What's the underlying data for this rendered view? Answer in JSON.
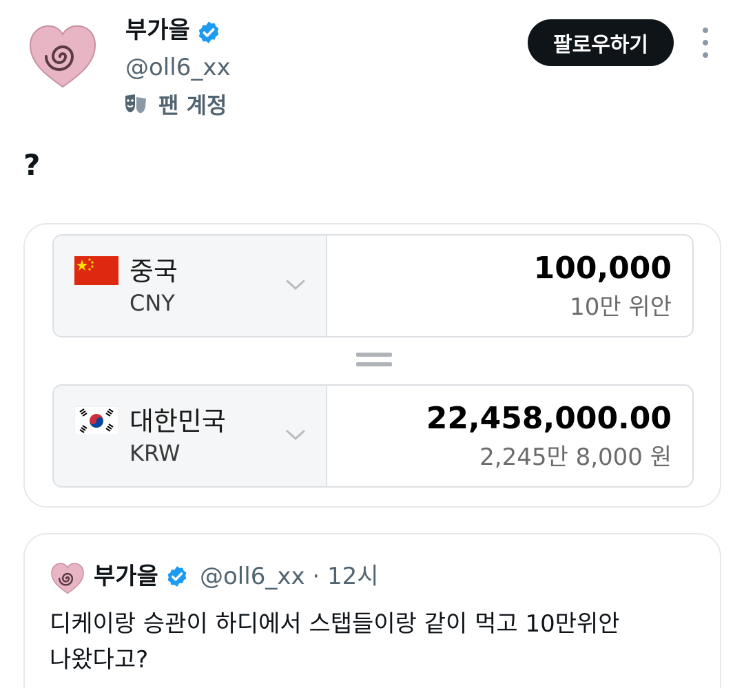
{
  "author": {
    "display_name": "부가을",
    "handle": "@oll6_xx",
    "account_label": "팬 계정",
    "avatar_icon": "heart-swirl-avatar",
    "verified_icon": "verified-badge-icon",
    "verified_color": "#1d9bf0"
  },
  "actions": {
    "follow_label": "팔로우하기",
    "more_icon": "more-vertical-icon"
  },
  "tweet": {
    "text": "?"
  },
  "converter": {
    "from": {
      "country": "중국",
      "code": "CNY",
      "amount": "100,000",
      "amount_words": "10만 위안",
      "flag_icon": "china-flag-icon"
    },
    "to": {
      "country": "대한민국",
      "code": "KRW",
      "amount": "22,458,000.00",
      "amount_words": "2,245만 8,000 원",
      "flag_icon": "korea-flag-icon"
    }
  },
  "quoted_tweet": {
    "display_name": "부가을",
    "handle": "@oll6_xx",
    "separator": "·",
    "time": "12시",
    "text_line1": "디케이랑 승관이 하디에서 스탭들이랑 같이 먹고 10만위안",
    "text_line2": "나왔다고?"
  }
}
